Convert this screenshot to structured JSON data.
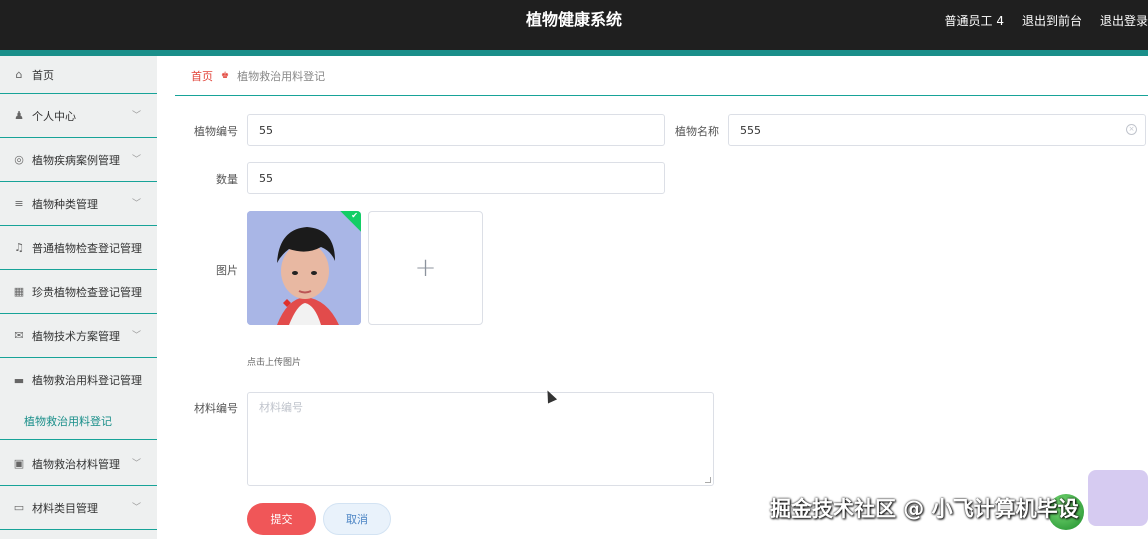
{
  "header": {
    "title": "植物健康系统",
    "user_label": "普通员工 4",
    "exit_front": "退出到前台",
    "logout": "退出登录"
  },
  "sidebar": {
    "items": [
      {
        "label": "首页",
        "icon": "home-icon",
        "glyph": "⌂"
      },
      {
        "label": "个人中心",
        "icon": "user-icon",
        "glyph": "♟"
      },
      {
        "label": "植物疾病案例管理",
        "icon": "circle-icon",
        "glyph": "◎"
      },
      {
        "label": "植物种类管理",
        "icon": "list-icon",
        "glyph": "≡"
      },
      {
        "label": "普通植物检查登记管理",
        "icon": "bell-off-icon",
        "glyph": "♫"
      },
      {
        "label": "珍贵植物检查登记管理",
        "icon": "grid-icon",
        "glyph": "▦"
      },
      {
        "label": "植物技术方案管理",
        "icon": "mail-icon",
        "glyph": "✉"
      },
      {
        "label": "植物救治用料登记管理",
        "icon": "folder-icon",
        "glyph": "▬"
      },
      {
        "label": "植物救治材料管理",
        "icon": "picture-icon",
        "glyph": "▣"
      },
      {
        "label": "材料类目管理",
        "icon": "card-icon",
        "glyph": "▭"
      }
    ],
    "active_sub": "植物救治用料登记"
  },
  "breadcrumb": {
    "home": "首页",
    "current": "植物救治用料登记"
  },
  "form": {
    "plant_no_label": "植物编号",
    "plant_no_value": "55",
    "plant_name_label": "植物名称",
    "plant_name_value": "555",
    "quantity_label": "数量",
    "quantity_value": "55",
    "image_label": "图片",
    "upload_hint": "点击上传图片",
    "material_no_label": "材料编号",
    "material_no_placeholder": "材料编号",
    "submit": "提交",
    "cancel": "取消"
  },
  "watermark": "掘金技术社区 @ 小飞计算机毕设",
  "colors": {
    "header_bg": "#1f1f1f",
    "accent": "#1a8f8a",
    "danger": "#f05658",
    "breadcrumb_home": "#e2453b"
  }
}
